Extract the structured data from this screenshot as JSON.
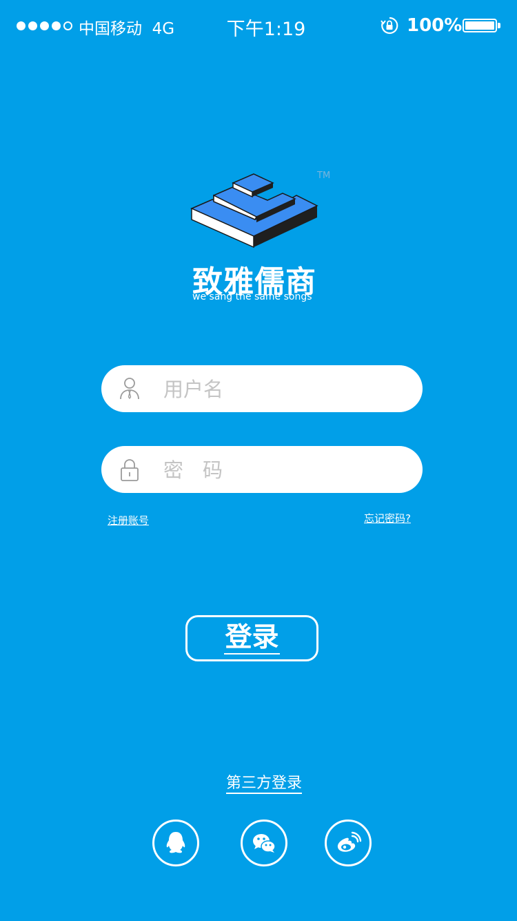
{
  "status_bar": {
    "carrier": "中国移动",
    "network": "4G",
    "time": "下午1:19",
    "battery": "100%",
    "signal_bars": 4
  },
  "brand": {
    "name": "致雅儒商",
    "tagline": "we sang the same songs",
    "trademark": "TM"
  },
  "form": {
    "username_placeholder": "用户名",
    "password_placeholder": "密码",
    "register_link": "注册账号",
    "forgot_link": "忘记密码?",
    "login_button": "登录"
  },
  "third_party": {
    "title": "第三方登录",
    "providers": [
      "qq-icon",
      "wechat-icon",
      "weibo-icon"
    ]
  },
  "colors": {
    "background": "#019fe8",
    "logo_blue": "#3a8df2",
    "logo_dark": "#1a1a1a"
  }
}
